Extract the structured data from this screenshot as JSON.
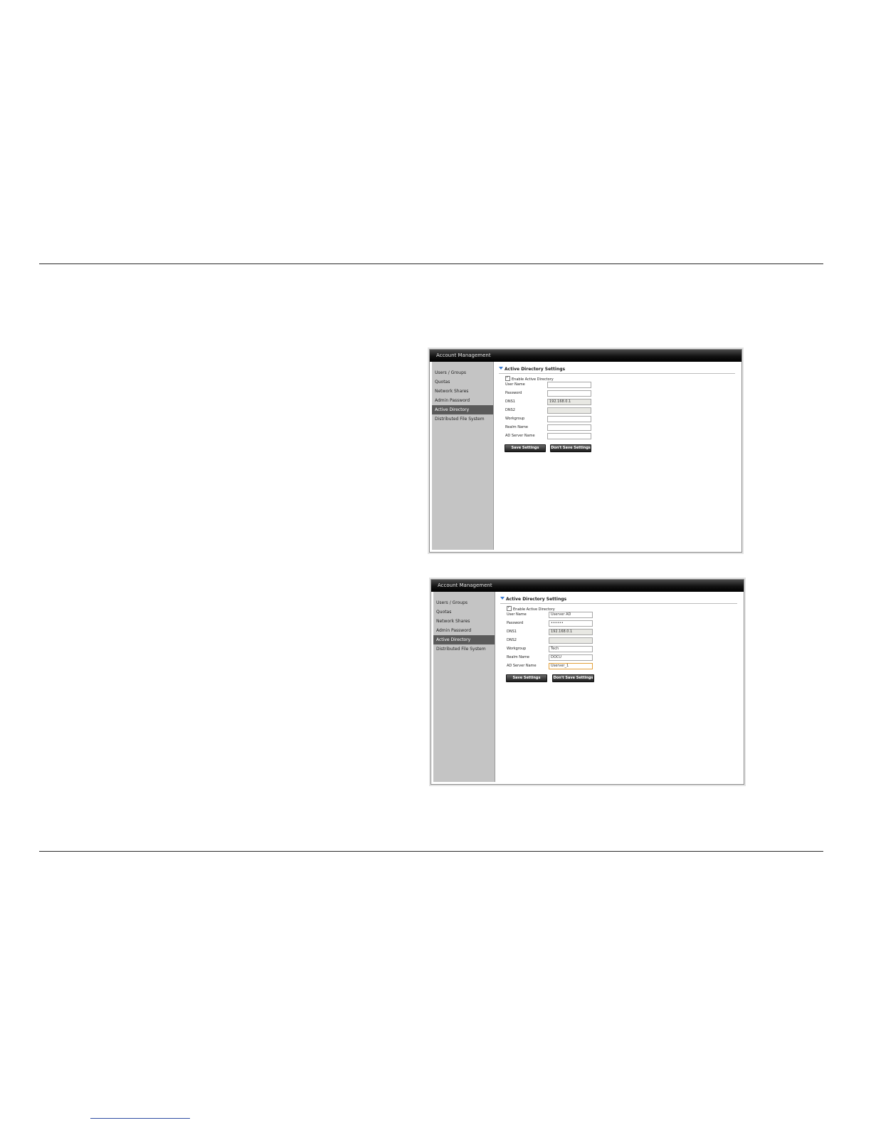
{
  "panels": [
    {
      "title": "Account Management",
      "sidebar": [
        "Users / Groups",
        "Quotas",
        "Network Shares",
        "Admin Password",
        "Active Directory",
        "Distributed File System"
      ],
      "active_index": 4,
      "section_title": "Active Directory Settings",
      "enable_label": "Enable Active Directory",
      "enable_checked": true,
      "fields": [
        {
          "label": "User Name",
          "value": ""
        },
        {
          "label": "Password",
          "value": ""
        },
        {
          "label": "DNS1",
          "value": "192.168.0.1"
        },
        {
          "label": "DNS2",
          "value": ""
        },
        {
          "label": "Workgroup",
          "value": ""
        },
        {
          "label": "Realm Name",
          "value": ""
        },
        {
          "label": "AD Server Name",
          "value": ""
        }
      ],
      "save_label": "Save Settings",
      "dont_save_label": "Don't Save Settings"
    },
    {
      "title": "Account Management",
      "sidebar": [
        "Users / Groups",
        "Quotas",
        "Network Shares",
        "Admin Password",
        "Active Directory",
        "Distributed File System"
      ],
      "active_index": 4,
      "section_title": "Active Directory Settings",
      "enable_label": "Enable Active Directory",
      "enable_checked": true,
      "fields": [
        {
          "label": "User Name",
          "value": "Userver AD"
        },
        {
          "label": "Password",
          "value": "••••••"
        },
        {
          "label": "DNS1",
          "value": "192.168.0.1"
        },
        {
          "label": "DNS2",
          "value": ""
        },
        {
          "label": "Workgroup",
          "value": "Tech"
        },
        {
          "label": "Realm Name",
          "value": "DOCU"
        },
        {
          "label": "AD Server Name",
          "value": "Userver_1"
        }
      ],
      "save_label": "Save Settings",
      "dont_save_label": "Don't Save Settings"
    }
  ]
}
